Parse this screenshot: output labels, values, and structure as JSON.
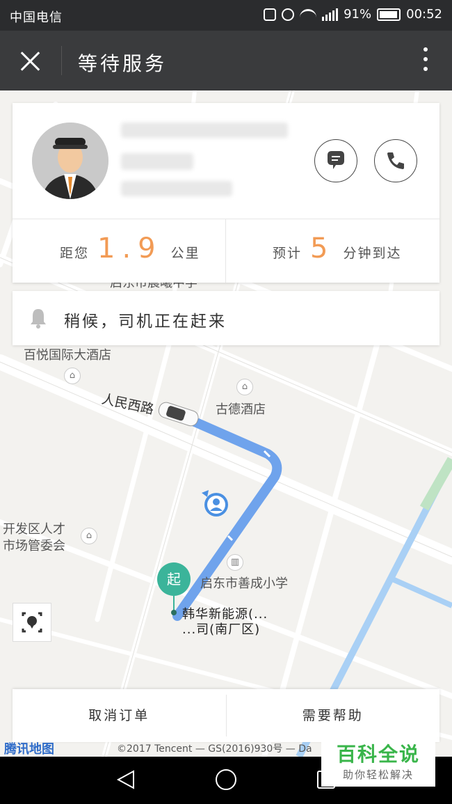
{
  "status_bar": {
    "carrier": "中国电信",
    "battery": "91%",
    "time": "00:52"
  },
  "header": {
    "title": "等待服务"
  },
  "driver_card": {
    "distance_prefix": "距您",
    "distance_value": "1.9",
    "distance_unit": "公里",
    "eta_prefix": "预计",
    "eta_value": "5",
    "eta_unit": "分钟到达"
  },
  "notice": {
    "text": "稍候，司机正在赶来"
  },
  "map": {
    "labels": {
      "hotel1": "百悦国际大酒店",
      "hotel2": "古德酒店",
      "road": "人民西路",
      "office_line1": "开发区人才",
      "office_line2": "市场管委会",
      "school": "启东市善成小学",
      "school_top": "启东市晨曦中学"
    },
    "route_color": "#6fa3ec",
    "start_badge": "起",
    "pickup_address_line1": "韩华新能源(...",
    "pickup_address_line2": "...司(南厂区)"
  },
  "bottom_bar": {
    "cancel": "取消订单",
    "help": "需要帮助"
  },
  "attribution": {
    "logo": "腾讯地图",
    "text": "©2017 Tencent — GS(2016)930号 — Da"
  },
  "watermark": {
    "title": "百科全说",
    "subtitle": "助你轻松解决"
  },
  "colors": {
    "accent_orange": "#f29b55",
    "start_green": "#3bb49a",
    "header_bg": "#3a3b3d"
  }
}
